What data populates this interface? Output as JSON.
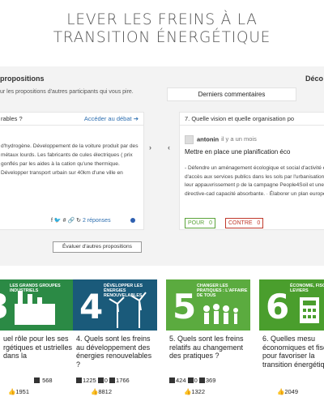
{
  "header": {
    "title_line1": "LEVER LES FREINS À LA",
    "title_line2": "TRANSITION ÉNERGÉTIQUE"
  },
  "propositions": {
    "label": "propositions",
    "intro": "ur les propositions d'autres participants qui vous pire.",
    "right_label": "Déco",
    "latest_button": "Derniers commentaires"
  },
  "left_card": {
    "question": "rables ?",
    "link": "Accéder au débat",
    "body": "d'hydrogène. Développement de la voiture produit par des métaux lourds. Les fabricants de cules électriques ( prix gonflés par les aides à la cation qu'une thermique. Développer transport urbain sur 40km d'une ville en",
    "answers": "2 réponses"
  },
  "right_card": {
    "question": "7. Quelle vision et quelle organisation po",
    "author": "antonin",
    "ago": "il y a un mois",
    "title": "Mettre en place une planification éco",
    "body": "- Défendre un aménagement écologique et social d'activité et d'accès aux services publics dans les sols par l'urbanisation et leur appauvrissement p de la campagne People4Soil et une directive-cad capacité absorbante. · Élaborer un plan européen",
    "pour_label": "POUR",
    "pour_count": "0",
    "contre_label": "CONTRE",
    "contre_count": "0"
  },
  "evaluate_button": "Évaluer d'autres propositions",
  "tiles": [
    {
      "number": "3",
      "header": "LES GRANDS GROUPES INDUSTRIELS",
      "color": "#2b8a45",
      "question": "uel rôle pour les ses rgétiques et ustrielles dans la",
      "participants": "",
      "comments": "",
      "views": "568",
      "votes": "1951"
    },
    {
      "number": "4",
      "header": "DÉVELOPPER LES ÉNERGIES RENOUVELABLES",
      "color": "#1a5a7a",
      "question": "4. Quels sont les freins au développement des énergies renouvelables ?",
      "participants": "1225",
      "comments": "0",
      "views": "1766",
      "votes": "8812"
    },
    {
      "number": "5",
      "header": "CHANGER LES PRATIQUES : L'AFFAIRE DE TOUS",
      "color": "#5bab3f",
      "question": "5. Quels sont les freins relatifs au changement des pratiques ?",
      "participants": "424",
      "comments": "0",
      "views": "369",
      "votes": "1322"
    },
    {
      "number": "6",
      "header": "ÉCONOMIE, FISC QUELS LEVIERS",
      "color": "#4a9e2d",
      "question": "6. Quelles mesu économiques et fiscales pour favoriser la transition énergétique ?",
      "participants": "",
      "comments": "",
      "views": "",
      "votes": "2049"
    }
  ]
}
